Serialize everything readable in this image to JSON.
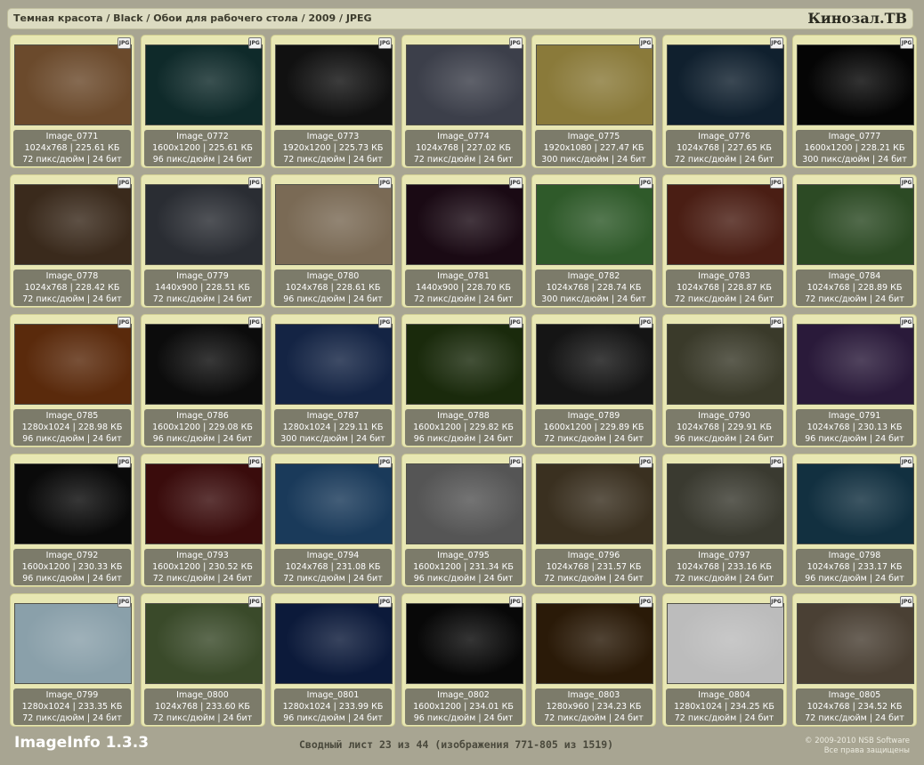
{
  "breadcrumb": "Темная красота / Black / Обои для рабочего стола / 2009 / JPEG",
  "brand": "Кинозал.ТВ",
  "format_badge": "JPG",
  "images": [
    {
      "name": "Image_0771",
      "ratio": "4:3",
      "dims_size": "1024x768 | 225.61 КБ",
      "dpi_bits": "72 пикс/дюйм | 24 бит",
      "bg": "#6b4a2c"
    },
    {
      "name": "Image_0772",
      "ratio": "4:3",
      "dims_size": "1600x1200 | 225.61 КБ",
      "dpi_bits": "96 пикс/дюйм | 24 бит",
      "bg": "#0f2a2a"
    },
    {
      "name": "Image_0773",
      "ratio": "16:10",
      "dims_size": "1920x1200 | 225.73 КБ",
      "dpi_bits": "72 пикс/дюйм | 24 бит",
      "bg": "#111111"
    },
    {
      "name": "Image_0774",
      "ratio": "4:3",
      "dims_size": "1024x768 | 227.02 КБ",
      "dpi_bits": "72 пикс/дюйм | 24 бит",
      "bg": "#3c3f4a"
    },
    {
      "name": "Image_0775",
      "ratio": "16:9",
      "dims_size": "1920x1080 | 227.47 КБ",
      "dpi_bits": "300 пикс/дюйм | 24 бит",
      "bg": "#8a7a3a"
    },
    {
      "name": "Image_0776",
      "ratio": "4:3",
      "dims_size": "1024x768 | 227.65 КБ",
      "dpi_bits": "72 пикс/дюйм | 24 бит",
      "bg": "#10202e"
    },
    {
      "name": "Image_0777",
      "ratio": "4:3",
      "dims_size": "1600x1200 | 228.21 КБ",
      "dpi_bits": "300 пикс/дюйм | 24 бит",
      "bg": "#050505"
    },
    {
      "name": "Image_0778",
      "ratio": "4:3",
      "dims_size": "1024x768 | 228.42 КБ",
      "dpi_bits": "72 пикс/дюйм | 24 бит",
      "bg": "#3a2a1c"
    },
    {
      "name": "Image_0779",
      "ratio": "16:10",
      "dims_size": "1440x900 | 228.51 КБ",
      "dpi_bits": "72 пикс/дюйм | 24 бит",
      "bg": "#2a2d33"
    },
    {
      "name": "Image_0780",
      "ratio": "4:3",
      "dims_size": "1024x768 | 228.61 КБ",
      "dpi_bits": "96 пикс/дюйм | 24 бит",
      "bg": "#7a6a55"
    },
    {
      "name": "Image_0781",
      "ratio": "16:10",
      "dims_size": "1440x900 | 228.70 КБ",
      "dpi_bits": "72 пикс/дюйм | 24 бит",
      "bg": "#1a0a14"
    },
    {
      "name": "Image_0782",
      "ratio": "4:3",
      "dims_size": "1024x768 | 228.74 КБ",
      "dpi_bits": "300 пикс/дюйм | 24 бит",
      "bg": "#2f5a2a"
    },
    {
      "name": "Image_0783",
      "ratio": "4:3",
      "dims_size": "1024x768 | 228.87 КБ",
      "dpi_bits": "72 пикс/дюйм | 24 бит",
      "bg": "#4a1e14"
    },
    {
      "name": "Image_0784",
      "ratio": "4:3",
      "dims_size": "1024x768 | 228.89 КБ",
      "dpi_bits": "72 пикс/дюйм | 24 бит",
      "bg": "#2c4a24"
    },
    {
      "name": "Image_0785",
      "ratio": "5:4",
      "dims_size": "1280x1024 | 228.98 КБ",
      "dpi_bits": "96 пикс/дюйм | 24 бит",
      "bg": "#5a2a0c"
    },
    {
      "name": "Image_0786",
      "ratio": "4:3",
      "dims_size": "1600x1200 | 229.08 КБ",
      "dpi_bits": "96 пикс/дюйм | 24 бит",
      "bg": "#0c0c0c"
    },
    {
      "name": "Image_0787",
      "ratio": "5:4",
      "dims_size": "1280x1024 | 229.11 КБ",
      "dpi_bits": "300 пикс/дюйм | 24 бит",
      "bg": "#142444"
    },
    {
      "name": "Image_0788",
      "ratio": "4:3",
      "dims_size": "1600x1200 | 229.82 КБ",
      "dpi_bits": "96 пикс/дюйм | 24 бит",
      "bg": "#1a2a0c"
    },
    {
      "name": "Image_0789",
      "ratio": "4:3",
      "dims_size": "1600x1200 | 229.89 КБ",
      "dpi_bits": "72 пикс/дюйм | 24 бит",
      "bg": "#151515"
    },
    {
      "name": "Image_0790",
      "ratio": "4:3",
      "dims_size": "1024x768 | 229.91 КБ",
      "dpi_bits": "96 пикс/дюйм | 24 бит",
      "bg": "#3a3a2a"
    },
    {
      "name": "Image_0791",
      "ratio": "4:3",
      "dims_size": "1024x768 | 230.13 КБ",
      "dpi_bits": "96 пикс/дюйм | 24 бит",
      "bg": "#2a1a3a"
    },
    {
      "name": "Image_0792",
      "ratio": "4:3",
      "dims_size": "1600x1200 | 230.33 КБ",
      "dpi_bits": "96 пикс/дюйм | 24 бит",
      "bg": "#0a0a0a"
    },
    {
      "name": "Image_0793",
      "ratio": "4:3",
      "dims_size": "1600x1200 | 230.52 КБ",
      "dpi_bits": "72 пикс/дюйм | 24 бит",
      "bg": "#3a0c0c"
    },
    {
      "name": "Image_0794",
      "ratio": "4:3",
      "dims_size": "1024x768 | 231.08 КБ",
      "dpi_bits": "72 пикс/дюйм | 24 бит",
      "bg": "#1a3a5a"
    },
    {
      "name": "Image_0795",
      "ratio": "4:3",
      "dims_size": "1600x1200 | 231.34 КБ",
      "dpi_bits": "96 пикс/дюйм | 24 бит",
      "bg": "#555555"
    },
    {
      "name": "Image_0796",
      "ratio": "4:3",
      "dims_size": "1024x768 | 231.57 КБ",
      "dpi_bits": "72 пикс/дюйм | 24 бит",
      "bg": "#3a3020"
    },
    {
      "name": "Image_0797",
      "ratio": "4:3",
      "dims_size": "1024x768 | 233.16 КБ",
      "dpi_bits": "72 пикс/дюйм | 24 бит",
      "bg": "#3a3a30"
    },
    {
      "name": "Image_0798",
      "ratio": "4:3",
      "dims_size": "1024x768 | 233.17 КБ",
      "dpi_bits": "96 пикс/дюйм | 24 бит",
      "bg": "#123040"
    },
    {
      "name": "Image_0799",
      "ratio": "5:4",
      "dims_size": "1280x1024 | 233.35 КБ",
      "dpi_bits": "72 пикс/дюйм | 24 бит",
      "bg": "#8aa0aa"
    },
    {
      "name": "Image_0800",
      "ratio": "4:3",
      "dims_size": "1024x768 | 233.60 КБ",
      "dpi_bits": "72 пикс/дюйм | 24 бит",
      "bg": "#3a4a2a"
    },
    {
      "name": "Image_0801",
      "ratio": "5:4",
      "dims_size": "1280x1024 | 233.99 КБ",
      "dpi_bits": "96 пикс/дюйм | 24 бит",
      "bg": "#0c1a3a"
    },
    {
      "name": "Image_0802",
      "ratio": "4:3",
      "dims_size": "1600x1200 | 234.01 КБ",
      "dpi_bits": "96 пикс/дюйм | 24 бит",
      "bg": "#080808"
    },
    {
      "name": "Image_0803",
      "ratio": "4:3",
      "dims_size": "1280x960 | 234.23 КБ",
      "dpi_bits": "72 пикс/дюйм | 24 бит",
      "bg": "#2a1a08"
    },
    {
      "name": "Image_0804",
      "ratio": "5:4",
      "dims_size": "1280x1024 | 234.25 КБ",
      "dpi_bits": "72 пикс/дюйм | 24 бит",
      "bg": "#bcbcbc"
    },
    {
      "name": "Image_0805",
      "ratio": "4:3",
      "dims_size": "1024x768 | 234.52 КБ",
      "dpi_bits": "72 пикс/дюйм | 24 бит",
      "bg": "#4a4034"
    }
  ],
  "footer": {
    "app_name": "ImageInfo 1.3.3",
    "summary": "Сводный лист 23 из 44 (изображения 771-805 из 1519)",
    "copyright": "© 2009-2010 NSB Software",
    "rights": "Все права защищены"
  }
}
